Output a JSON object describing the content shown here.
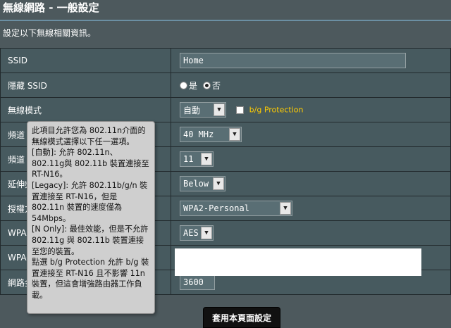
{
  "page": {
    "title": "無線網路 - 一般設定",
    "description": "設定以下無線相關資訊。"
  },
  "fields": {
    "ssid": {
      "label": "SSID",
      "value": "Home"
    },
    "hide_ssid": {
      "label": "隱藏 SSID",
      "yes": "是",
      "no": "否",
      "selected": "否"
    },
    "wireless_mode": {
      "label": "無線模式",
      "value": "自動",
      "bg_protection": "b/g Protection",
      "bg_checked": false
    },
    "channel_bandwidth": {
      "label": "頻道",
      "value": "40 MHz"
    },
    "control_channel": {
      "label": "頻道",
      "value": "11"
    },
    "extension_channel": {
      "label": "延伸頻",
      "value": "Below"
    },
    "auth_method": {
      "label": "授權方",
      "value": "WPA2-Personal"
    },
    "wpa_encryption": {
      "label": "WPA",
      "value": "AES"
    },
    "wpa_key": {
      "label": "WPA-"
    },
    "key_rotation": {
      "label": "網路金",
      "value": "3600"
    }
  },
  "tooltip": {
    "lines": [
      "此項目允許您為 802.11n介面的無線模式選擇以下任一選項。",
      "[自動]: 允許 802.11n、802.11g與 802.11b 裝置連接至 RT-N16。",
      "[Legacy]: 允許 802.11b/g/n 裝置連接至 RT-N16，但是 802.11n 裝置的速度僅為 54Mbps。",
      "[N Only]: 最佳效能，但是不允許 802.11g 與 802.11b 裝置連接至您的裝置。",
      "點選 b/g Protection 允許 b/g 裝置連接至 RT-N16 且不影響 11n 裝置，但這會增強路由器工作負載。"
    ]
  },
  "apply_button": {
    "label": "套用本頁面設定"
  },
  "colors": {
    "background": "#4d595d",
    "row": "#475a5f",
    "accent_yellow": "#ffcc00",
    "tooltip_bg": "#cfcfcf"
  }
}
